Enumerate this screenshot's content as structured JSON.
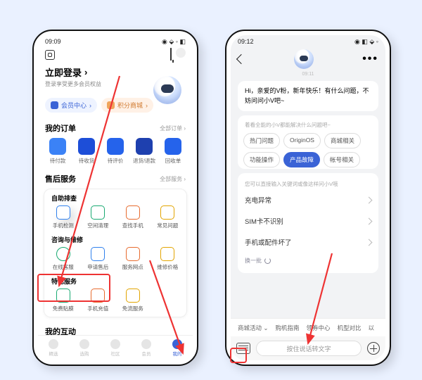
{
  "left": {
    "status_time": "09:09",
    "status_icons": "◉ ⬙ ◦ ◧",
    "login_title": "立即登录",
    "login_sub": "登录享受更多会员权益",
    "chip_member": "会员中心",
    "chip_points": "积分商城",
    "orders_title": "我的订单",
    "orders_more": "全部订单 ›",
    "orders": [
      "待付款",
      "待收货",
      "待评价",
      "退货/退款",
      "回收单"
    ],
    "aftersale_title": "售后服务",
    "aftersale_more": "全部服务 ›",
    "self_title": "自助排查",
    "self": [
      "手机检测",
      "空间清理",
      "查找手机",
      "常见问题"
    ],
    "consult_title": "咨询与维修",
    "consult": [
      "在线客服",
      "申请售后",
      "服务网点",
      "维修价格"
    ],
    "special_title": "特色服务",
    "special": [
      "免费贴膜",
      "手机充值",
      "免流服务"
    ],
    "interact_title": "我的互动",
    "tabs": [
      "精选",
      "选购",
      "社区",
      "会员",
      "我的"
    ]
  },
  "right": {
    "status_time": "09:12",
    "status_icons": "◉ ◧ ⬙ ◦",
    "conv_time": "09:11",
    "greeting": "Hi，亲爱的V粉，新年快乐！有什么问题，不妨问问小V吧~",
    "panel_hint": "着看全能的小V都能解决什么问题吧~",
    "pills": [
      "热门问题",
      "OriginOS",
      "商城相关",
      "功能操作",
      "产品故障",
      "帐号相关"
    ],
    "active_pill_index": 4,
    "q_hint": "您可以直接输入关键词或像这样问小V哦",
    "questions": [
      "充电异常",
      "SIM卡不识别",
      "手机或配件坏了"
    ],
    "refresh": "换一批",
    "tags": [
      "商城活动",
      "购机指南",
      "领券中心",
      "机型对比",
      "以"
    ],
    "talk_placeholder": "按住说话转文字"
  }
}
